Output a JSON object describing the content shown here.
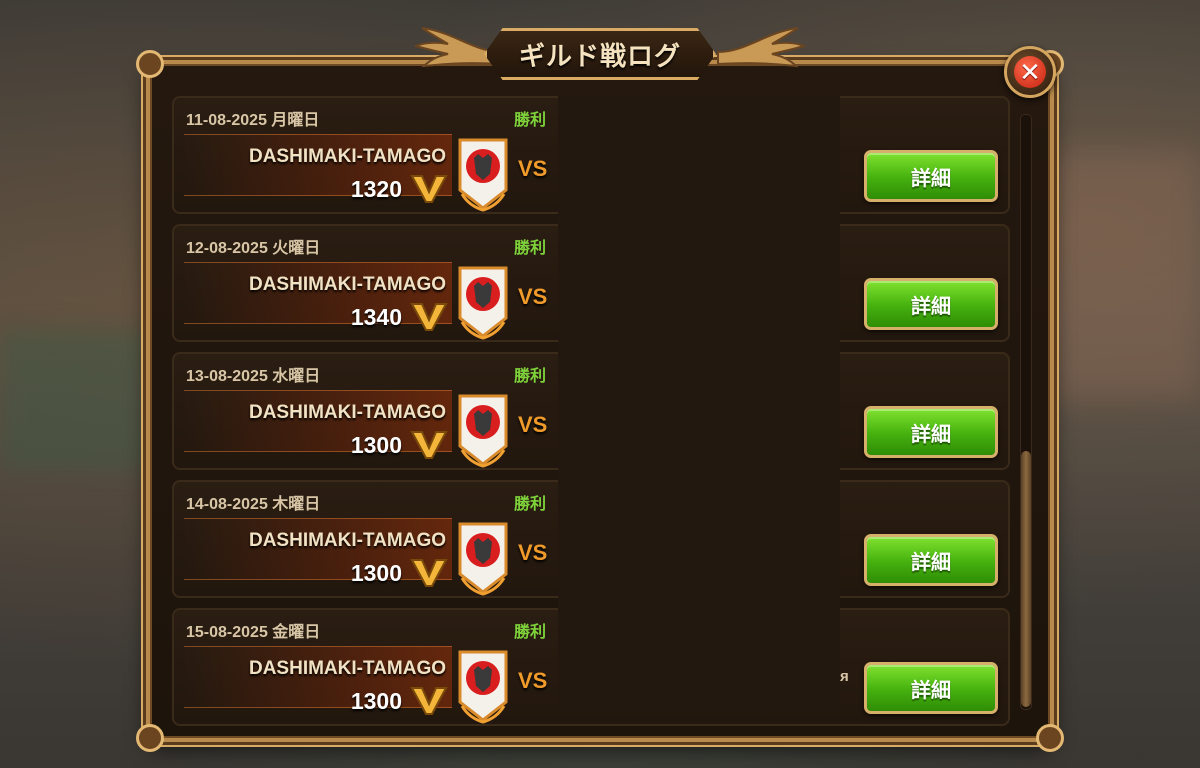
{
  "dialog": {
    "title": "ギルド戦ログ",
    "close_icon": "close-icon"
  },
  "colors": {
    "result_win": "#7ed33a",
    "detail_button": "#45b00e",
    "frame_gold": "#d9ab64",
    "vs_orange": "#f09a2a"
  },
  "scroll": {
    "position_fraction": 1.0
  },
  "entries": [
    {
      "date": "11-08-2025 月曜日",
      "result": "勝利",
      "guild": "DASHIMAKI-TAMAGO",
      "score": "1320",
      "vs": "VS",
      "opponent_suffix": "",
      "detail": "詳細"
    },
    {
      "date": "12-08-2025 火曜日",
      "result": "勝利",
      "guild": "DASHIMAKI-TAMAGO",
      "score": "1340",
      "vs": "VS",
      "opponent_suffix": "",
      "detail": "詳細"
    },
    {
      "date": "13-08-2025 水曜日",
      "result": "勝利",
      "guild": "DASHIMAKI-TAMAGO",
      "score": "1300",
      "vs": "VS",
      "opponent_suffix": "",
      "detail": "詳細"
    },
    {
      "date": "14-08-2025 木曜日",
      "result": "勝利",
      "guild": "DASHIMAKI-TAMAGO",
      "score": "1300",
      "vs": "VS",
      "opponent_suffix": "",
      "detail": "詳細"
    },
    {
      "date": "15-08-2025 金曜日",
      "result": "勝利",
      "guild": "DASHIMAKI-TAMAGO",
      "score": "1300",
      "vs": "VS",
      "opponent_suffix": "я",
      "detail": "詳細"
    }
  ]
}
